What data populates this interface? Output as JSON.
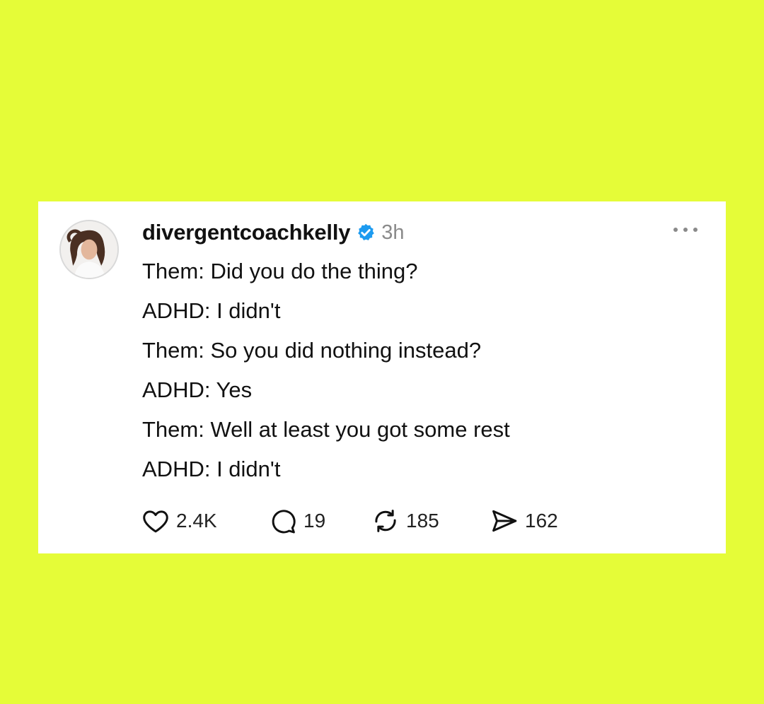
{
  "post": {
    "username": "divergentcoachkelly",
    "time": "3h",
    "lines": [
      "Them: Did you do the thing?",
      "ADHD: I didn't",
      "Them: So you did nothing instead?",
      "ADHD: Yes",
      "Them: Well at least you got some rest",
      "ADHD: I didn't"
    ],
    "actions": {
      "likes": "2.4K",
      "replies": "19",
      "reposts": "185",
      "shares": "162"
    }
  },
  "icons": {
    "verified": "verified-badge-icon",
    "more": "more-options-icon",
    "like": "heart-icon",
    "reply": "speech-bubble-icon",
    "repost": "repost-icon",
    "share": "send-icon"
  },
  "colors": {
    "background": "#e5fc38",
    "card": "#ffffff",
    "verified": "#1d9bf0",
    "muted": "#8a8a8a"
  }
}
